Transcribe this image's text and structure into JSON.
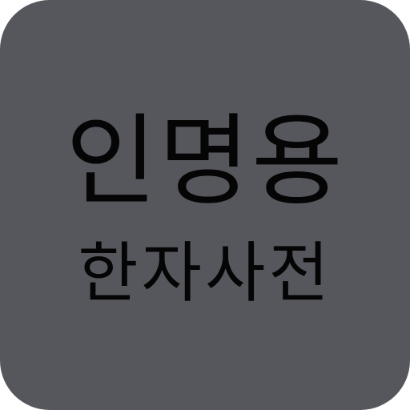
{
  "app_icon": {
    "line1": "인명용",
    "line2": "한자사전",
    "background_color": "#56575d",
    "text_color": "#050505"
  }
}
